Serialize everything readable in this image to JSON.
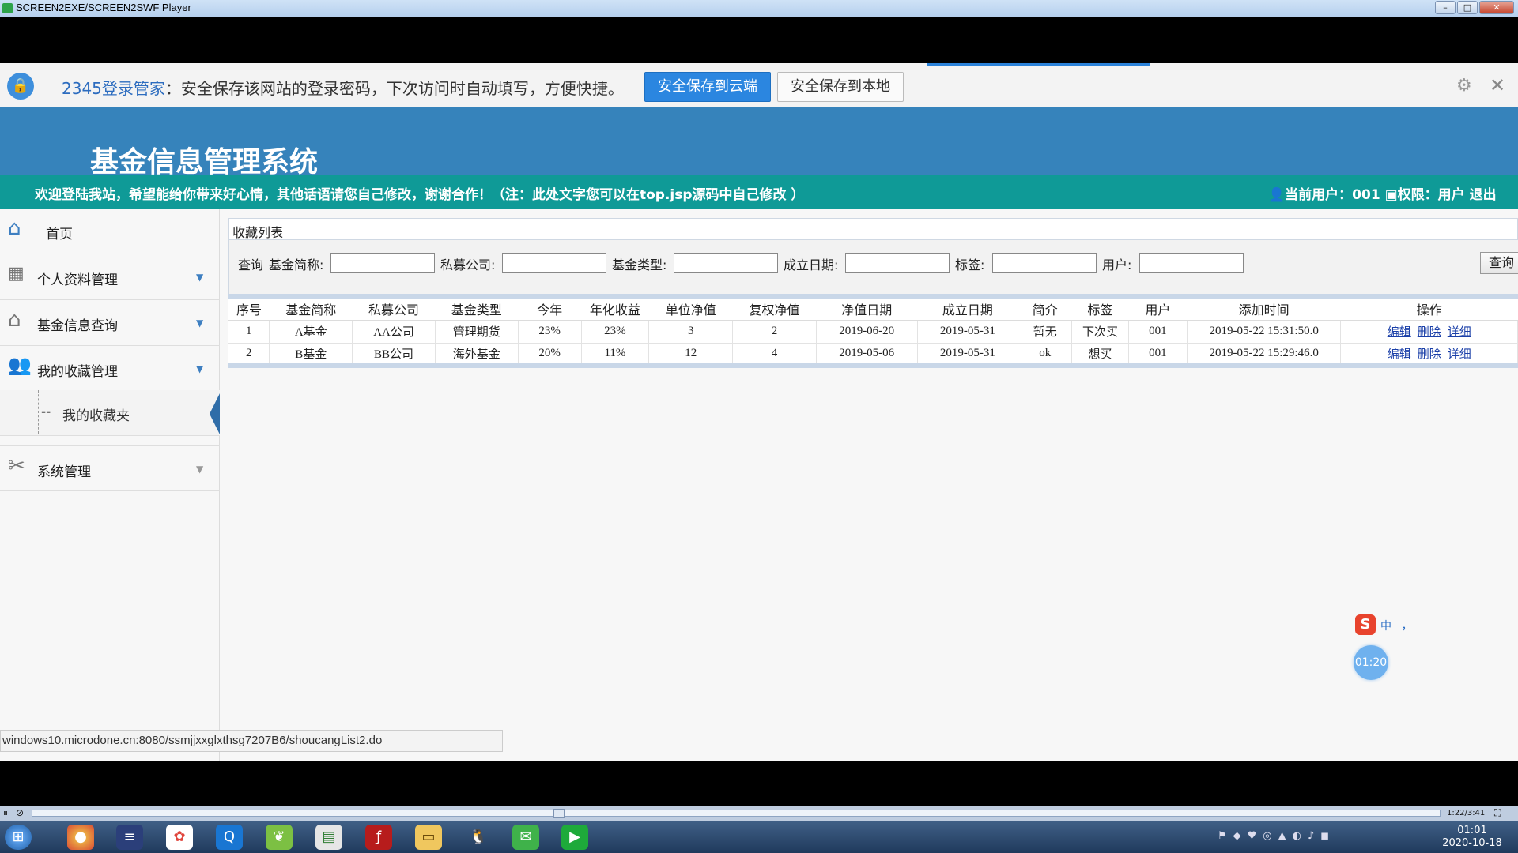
{
  "window": {
    "title": "SCREEN2EXE/SCREEN2SWF Player"
  },
  "pwbar": {
    "brand": "2345登录管家",
    "message": "：安全保存该网站的登录密码，下次访问时自动填写，方便快捷。",
    "cloud_button": "安全保存到云端",
    "local_button": "安全保存到本地"
  },
  "header": {
    "title": "基金信息管理系统",
    "welcome": "欢迎登陆我站，希望能给你带来好心情，其他话语请您自己修改，谢谢合作！（注：此处文字您可以在top.jsp源码中自己修改 ）",
    "user_info": "当前用户：001",
    "role_info": "权限：用户",
    "logout": "退出"
  },
  "sidebar": {
    "items": [
      {
        "label": "首页",
        "icon": "home-icon"
      },
      {
        "label": "个人资料管理",
        "icon": "grid-icon"
      },
      {
        "label": "基金信息查询",
        "icon": "house-icon"
      },
      {
        "label": "我的收藏管理",
        "icon": "users-icon"
      },
      {
        "label": "我的收藏夹",
        "icon": ""
      },
      {
        "label": "系统管理",
        "icon": "tools-icon"
      }
    ]
  },
  "panel": {
    "title": "收藏列表"
  },
  "search": {
    "prefix": "查询",
    "fields": [
      "基金简称:",
      "私募公司:",
      "基金类型:",
      "成立日期:",
      "标签:",
      "用户:"
    ],
    "button": "查询"
  },
  "table": {
    "headers": [
      "序号",
      "基金简称",
      "私募公司",
      "基金类型",
      "今年",
      "年化收益",
      "单位净值",
      "复权净值",
      "净值日期",
      "成立日期",
      "简介",
      "标签",
      "用户",
      "添加时间",
      "操作"
    ],
    "rows": [
      [
        "1",
        "A基金",
        "AA公司",
        "管理期货",
        "23%",
        "23%",
        "3",
        "2",
        "2019-06-20",
        "2019-05-31",
        "暂无",
        "下次买",
        "001",
        "2019-05-22 15:31:50.0"
      ],
      [
        "2",
        "B基金",
        "BB公司",
        "海外基金",
        "20%",
        "11%",
        "12",
        "4",
        "2019-05-06",
        "2019-05-31",
        "ok",
        "想买",
        "001",
        "2019-05-22 15:29:46.0"
      ]
    ],
    "actions": [
      "编辑",
      "删除",
      "详细"
    ]
  },
  "status_url": "windows10.microdone.cn:8080/ssmjjxxglxthsg7207B6/shoucangList2.do",
  "widgets": {
    "timer": "01:20",
    "ime": "中 ，"
  },
  "player": {
    "time": "1:22/3:41"
  },
  "taskbar": {
    "time": "01:01",
    "date": "2020-10-18"
  },
  "colors": {
    "header": "#3683bb",
    "welcome_bar": "#0f9a97",
    "accent": "#2b86e0"
  }
}
